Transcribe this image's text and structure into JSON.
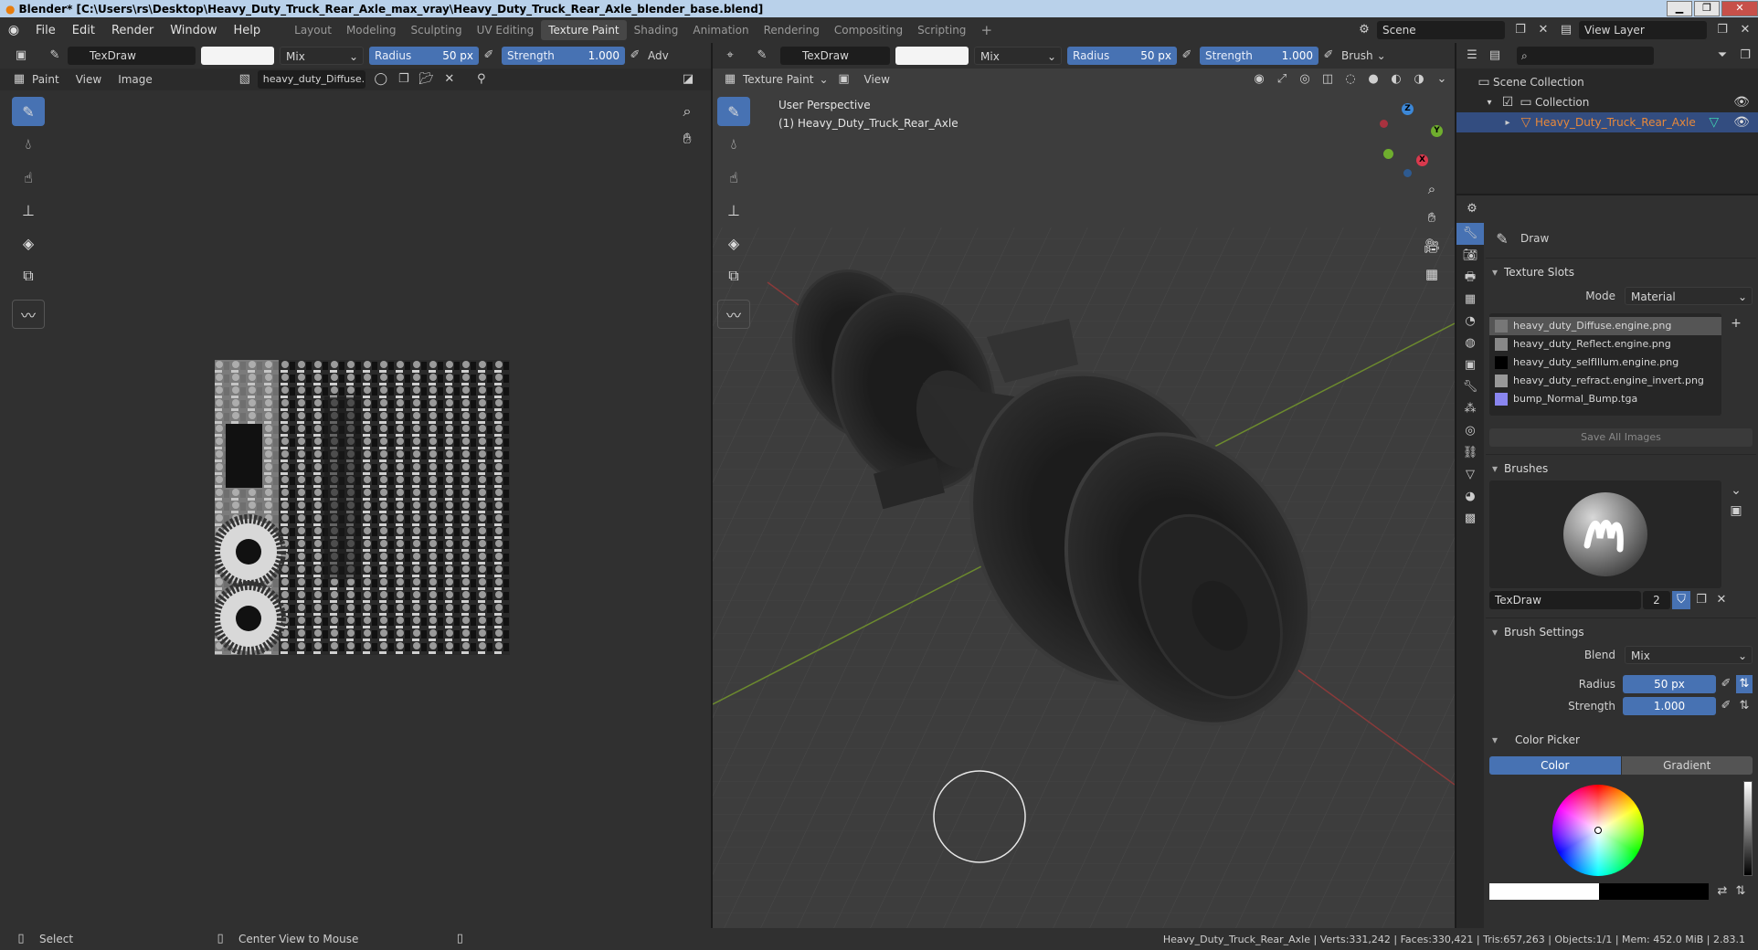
{
  "window": {
    "title": "Blender* [C:\\Users\\rs\\Desktop\\Heavy_Duty_Truck_Rear_Axle_max_vray\\Heavy_Duty_Truck_Rear_Axle_blender_base.blend]"
  },
  "menus": [
    "File",
    "Edit",
    "Render",
    "Window",
    "Help"
  ],
  "workspaces": [
    "Layout",
    "Modeling",
    "Sculpting",
    "UV Editing",
    "Texture Paint",
    "Shading",
    "Animation",
    "Rendering",
    "Compositing",
    "Scripting"
  ],
  "active_workspace": "Texture Paint",
  "scene": {
    "label": "Scene",
    "view_layer": "View Layer"
  },
  "left_tool_header": {
    "brush_name": "TexDraw",
    "blend": "Mix",
    "radius_label": "Radius",
    "radius_value": "50 px",
    "strength_label": "Strength",
    "strength_value": "1.000",
    "adv": "Adv"
  },
  "image_editor": {
    "mode": "Paint",
    "menu_view": "View",
    "menu_image": "Image",
    "image_name": "heavy_duty_Diffuse..."
  },
  "right_tool_header": {
    "brush_name": "TexDraw",
    "blend": "Mix",
    "radius_label": "Radius",
    "radius_value": "50 px",
    "strength_label": "Strength",
    "strength_value": "1.000",
    "brush_menu": "Brush"
  },
  "viewport": {
    "mode": "Texture Paint",
    "menu_view": "View",
    "overlay_line1": "User Perspective",
    "overlay_line2": "(1) Heavy_Duty_Truck_Rear_Axle"
  },
  "gizmo": {
    "z": "Z",
    "y": "Y",
    "x": "X"
  },
  "outliner": {
    "scene_collection": "Scene Collection",
    "collection": "Collection",
    "object": "Heavy_Duty_Truck_Rear_Axle"
  },
  "properties": {
    "tool_name": "Draw",
    "texture_slots": {
      "title": "Texture Slots",
      "mode_label": "Mode",
      "mode_value": "Material",
      "slots": [
        "heavy_duty_Diffuse.engine.png",
        "heavy_duty_Reflect.engine.png",
        "heavy_duty_selfIllum.engine.png",
        "heavy_duty_refract.engine_invert.png",
        "bump_Normal_Bump.tga"
      ],
      "save_all": "Save All Images"
    },
    "brushes": {
      "title": "Brushes",
      "brush_name": "TexDraw",
      "users": "2"
    },
    "brush_settings": {
      "title": "Brush Settings",
      "blend_label": "Blend",
      "blend_value": "Mix",
      "radius_label": "Radius",
      "radius_value": "50 px",
      "strength_label": "Strength",
      "strength_value": "1.000"
    },
    "color_picker": {
      "title": "Color Picker",
      "tab_color": "Color",
      "tab_gradient": "Gradient"
    }
  },
  "status": {
    "select": "Select",
    "center_view": "Center View to Mouse",
    "stats": "Heavy_Duty_Truck_Rear_Axle | Verts:331,242 | Faces:330,421 | Tris:657,263 | Objects:1/1 | Mem: 452.0 MiB | 2.83.1"
  },
  "colors": {
    "accent": "#4772b3",
    "active_object": "#e8893a",
    "bg": "#303030",
    "viewport_bg": "#3d3d3d"
  }
}
